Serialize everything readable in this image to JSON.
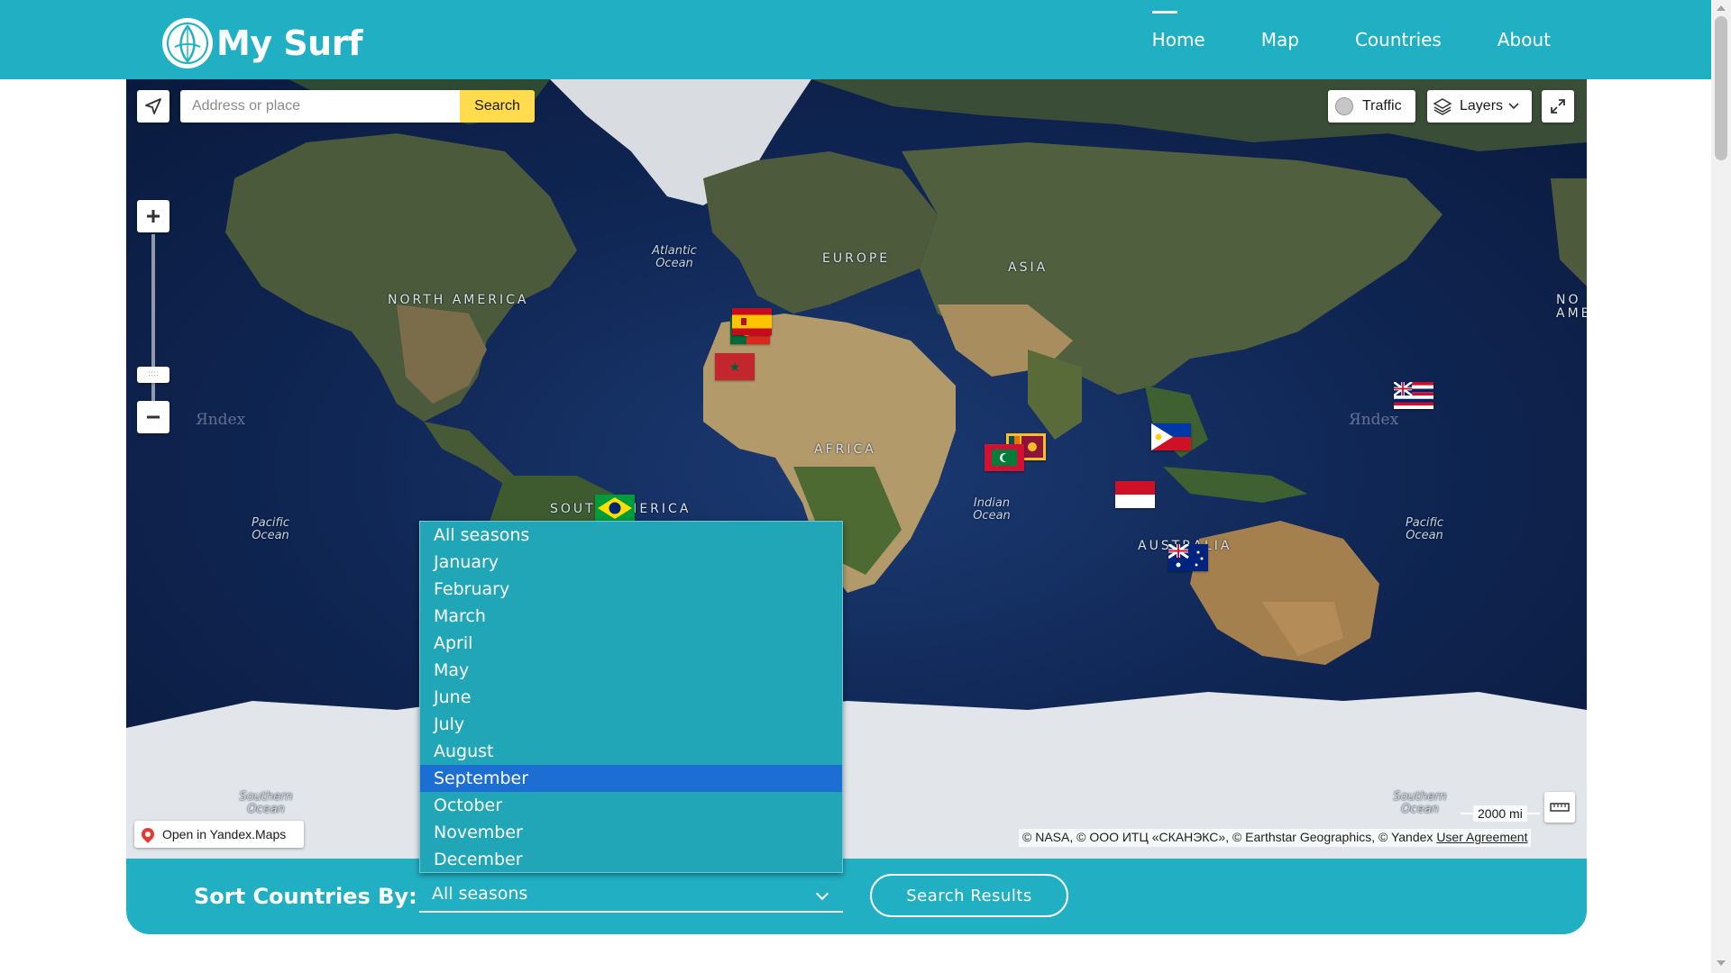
{
  "header": {
    "logo_text": "My Surf",
    "nav": [
      "Home",
      "Map",
      "Countries",
      "About"
    ],
    "active_nav": "Home"
  },
  "map": {
    "search_placeholder": "Address or place",
    "search_button": "Search",
    "traffic_label": "Traffic",
    "layers_label": "Layers",
    "open_in_yandex": "Open in Yandex.Maps",
    "scale_label": "2000 mi",
    "copyright": "© NASA, © ООО ИТЦ «СКАНЭКС», © Earthstar Geographics, © Yandex",
    "user_agreement": "User Agreement",
    "watermark": "Яndex",
    "continent_labels": {
      "north_america": "NORTH AMERICA",
      "europe": "EUROPE",
      "asia": "ASIA",
      "africa": "AFRICA",
      "south_america": "SOUTH AMERICA",
      "australia": "AUSTRALIA",
      "north_america_right": "NO AME"
    },
    "ocean_labels": {
      "atlantic": "Atlantic Ocean",
      "indian": "Indian Ocean",
      "pacific_left": "Pacific Ocean",
      "pacific_right": "Pacific Ocean",
      "southern_left": "Southern Ocean",
      "southern_right": "Southern Ocean"
    },
    "flags": [
      "spain",
      "portugal",
      "morocco",
      "brazil",
      "sri-lanka",
      "maldives",
      "philippines",
      "indonesia",
      "australia",
      "hawaii"
    ]
  },
  "filter": {
    "sort_label": "Sort Countries By:",
    "selected_value": "All seasons",
    "button_label": "Search Results",
    "dropdown_highlighted": "September",
    "options": [
      "All seasons",
      "January",
      "February",
      "March",
      "April",
      "May",
      "June",
      "July",
      "August",
      "September",
      "October",
      "November",
      "December"
    ]
  },
  "colors": {
    "brand": "#21b0c3",
    "dropdown_bg": "#21a6b8",
    "highlight": "#1c6ed3",
    "yandex_yellow": "#ffdb4d"
  }
}
